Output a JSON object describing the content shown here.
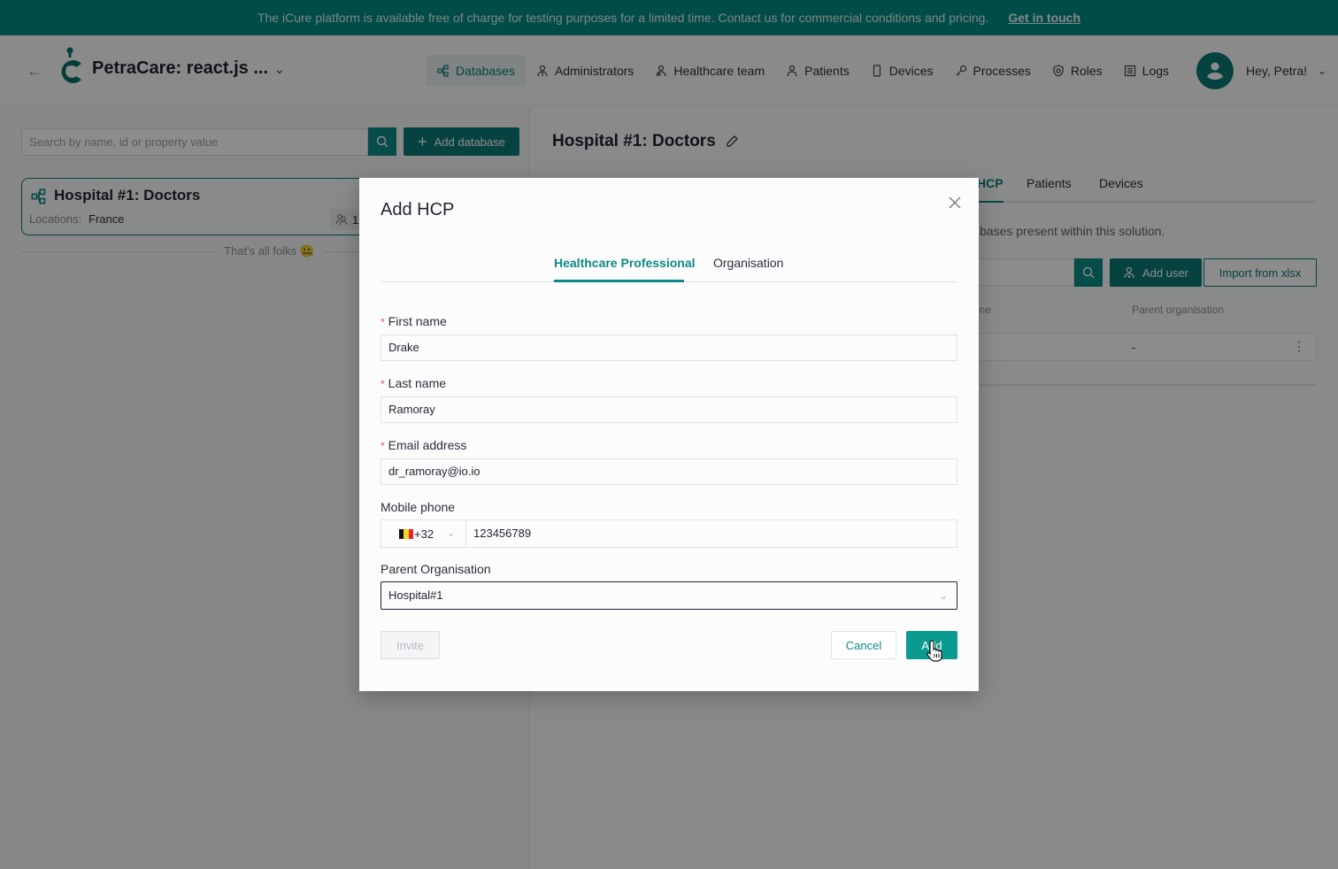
{
  "banner": {
    "message": "The iCure platform is available free of charge for testing purposes for a limited time. Contact us for commercial conditions and pricing.",
    "cta": "Get in touch"
  },
  "header": {
    "app_title": "PetraCare: react.js ...",
    "nav": [
      {
        "label": "Databases",
        "icon": "databases-icon",
        "active": true
      },
      {
        "label": "Administrators",
        "icon": "administrator-icon"
      },
      {
        "label": "Healthcare team",
        "icon": "healthcare-team-icon"
      },
      {
        "label": "Patients",
        "icon": "patient-icon"
      },
      {
        "label": "Devices",
        "icon": "device-icon"
      },
      {
        "label": "Processes",
        "icon": "key-icon"
      },
      {
        "label": "Roles",
        "icon": "shield-icon"
      },
      {
        "label": "Logs",
        "icon": "logs-icon"
      }
    ],
    "user_greeting": "Hey, Petra!"
  },
  "sidebar": {
    "search_placeholder": "Search by name, id or property value",
    "add_database_label": "Add database",
    "databases": [
      {
        "name": "Hospital #1: Doctors",
        "locations_label": "Locations:",
        "locations": "France",
        "user_count": "1"
      }
    ],
    "end_message": "That's all folks 🤐"
  },
  "main": {
    "title": "Hospital #1: Doctors",
    "tabs": [
      {
        "label": "HCP",
        "active": true
      },
      {
        "label": "Patients"
      },
      {
        "label": "Devices"
      }
    ],
    "description_visible": "bases present within this solution.",
    "add_user_label": "Add user",
    "import_label": "Import from xlsx",
    "columns": [
      "one",
      "Parent organisation"
    ],
    "rows": [
      {
        "parent_organisation": "-"
      }
    ]
  },
  "modal": {
    "title": "Add HCP",
    "tabs": [
      {
        "label": "Healthcare Professional",
        "active": true
      },
      {
        "label": "Organisation"
      }
    ],
    "fields": {
      "first_name": {
        "label": "First name",
        "required": true,
        "value": "Drake"
      },
      "last_name": {
        "label": "Last name",
        "required": true,
        "value": "Ramoray"
      },
      "email": {
        "label": "Email address",
        "required": true,
        "value": "dr_ramoray@io.io"
      },
      "mobile_phone": {
        "label": "Mobile phone",
        "country_code": "+32",
        "country_flag": "Belgium",
        "value": "123456789"
      },
      "parent_organisation": {
        "label": "Parent Organisation",
        "value": "Hospital#1"
      }
    },
    "buttons": {
      "invite": "Invite",
      "cancel": "Cancel",
      "add": "Add"
    }
  },
  "colors": {
    "brand_teal": "#0b7a76",
    "accent_teal": "#0b8a84",
    "required_red": "#e55353"
  }
}
